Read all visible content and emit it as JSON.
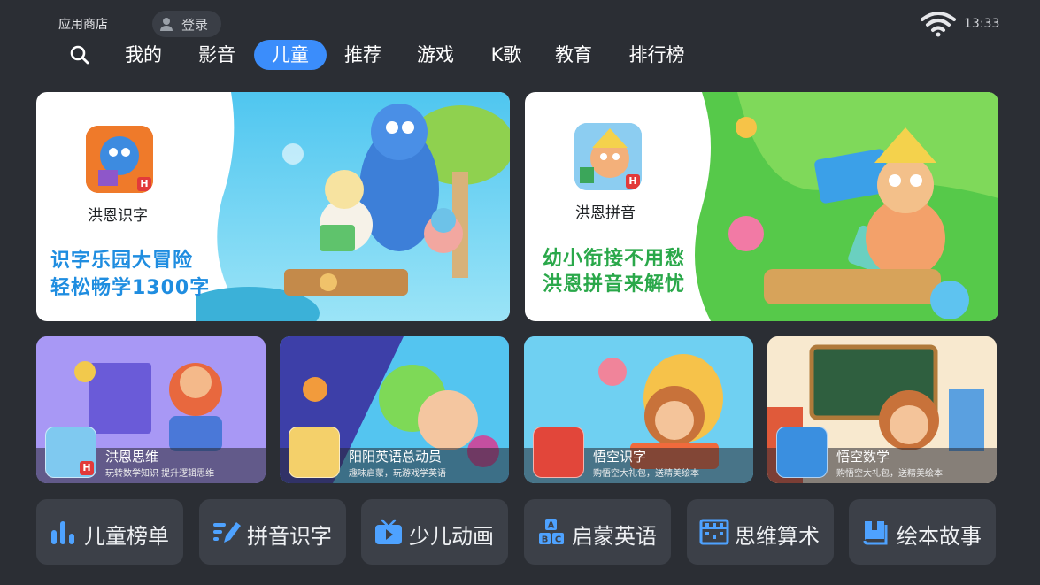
{
  "header": {
    "store_name": "应用商店",
    "login_label": "登录",
    "time": "13:33"
  },
  "nav": {
    "tabs": [
      {
        "label": "我的"
      },
      {
        "label": "影音"
      },
      {
        "label": "儿童",
        "active": true
      },
      {
        "label": "推荐"
      },
      {
        "label": "游戏"
      },
      {
        "label": "K歌"
      },
      {
        "label": "教育"
      },
      {
        "label": "排行榜"
      }
    ]
  },
  "banners": [
    {
      "app_name": "洪恩识字",
      "badge": "H",
      "slogan_lines": [
        "识字乐园大冒险",
        "轻松畅学1300字"
      ]
    },
    {
      "app_name": "洪恩拼音",
      "badge": "H",
      "slogan_lines": [
        "幼小衔接不用愁",
        "洪恩拼音来解忧"
      ]
    }
  ],
  "small_cards": [
    {
      "title": "洪恩思维",
      "subtitle": "玩转数学知识 提升逻辑思维",
      "badge": "H"
    },
    {
      "title": "阳阳英语总动员",
      "subtitle": "趣味启蒙，玩游戏学英语"
    },
    {
      "title": "悟空识字",
      "subtitle": "购悟空大礼包，送精美绘本"
    },
    {
      "title": "悟空数学",
      "subtitle": "购悟空大礼包，送精美绘本"
    }
  ],
  "quick_links": [
    {
      "label": "儿童榜单",
      "icon": "bar-chart-icon"
    },
    {
      "label": "拼音识字",
      "icon": "pencil-icon"
    },
    {
      "label": "少儿动画",
      "icon": "tv-play-icon"
    },
    {
      "label": "启蒙英语",
      "icon": "abc-blocks-icon"
    },
    {
      "label": "思维算术",
      "icon": "abacus-icon"
    },
    {
      "label": "绘本故事",
      "icon": "book-icon"
    }
  ],
  "colors": {
    "background": "#2b2e34",
    "active_tab": "#3b8dfb",
    "slogan_blue": "#1f8de0",
    "slogan_green": "#2aa84a"
  }
}
